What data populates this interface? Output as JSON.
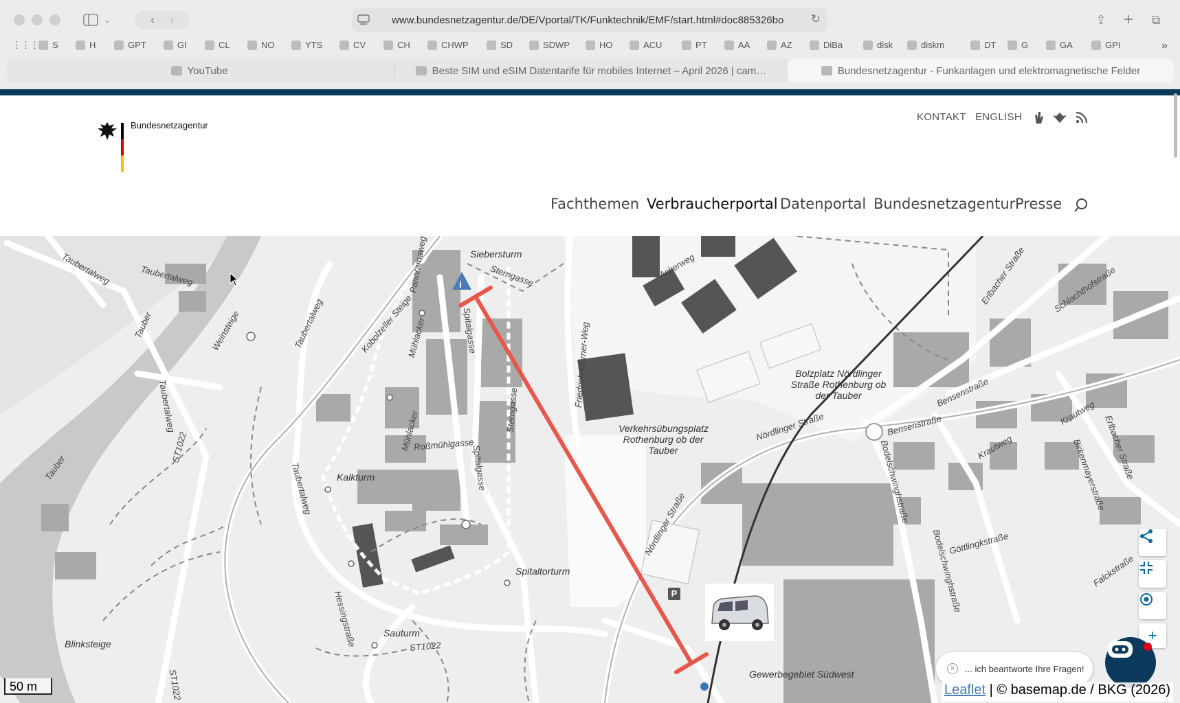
{
  "browser": {
    "url": "www.bundesnetzagentur.de/DE/Vportal/TK/Funktechnik/EMF/start.html#doc885326bo",
    "bookmarks": [
      "S",
      "H",
      "GPT",
      "GI",
      "CL",
      "NO",
      "YTS",
      "CV",
      "CH",
      "CHWP",
      "SD",
      "SDWP",
      "HO",
      "ACU",
      "PT",
      "AA",
      "AZ",
      "DiBa",
      "disk",
      "diskm",
      "DT",
      "G",
      "GA",
      "GPI"
    ],
    "tabs": [
      {
        "label": "YouTube",
        "active": false
      },
      {
        "label": "Beste SIM und eSIM Datentarife für mobiles Internet – April 2026 | cam…",
        "active": false
      },
      {
        "label": "Bundesnetzagentur - Funkanlagen und elektromagnetische Felder",
        "active": true
      }
    ]
  },
  "site": {
    "logo_text": "Bundesnetzagentur",
    "meta_links": [
      "KONTAKT",
      "ENGLISH"
    ],
    "nav": [
      "Fachthemen",
      "Verbraucherportal",
      "Datenportal",
      "Bundesnetzagentur",
      "Presse"
    ],
    "active_nav": "Verbraucherportal"
  },
  "map": {
    "street_labels": [
      "Taubertalweg",
      "Taubertalweg",
      "Taubertalweg",
      "Taubertalweg",
      "Taubertalweg",
      "Weinsteige",
      "Kobolzeller Steige",
      "Mühlacker",
      "Mühlacker",
      "Roßmühlgasse",
      "Panoramaweg",
      "Spitalgasse",
      "Spitalgasse",
      "Sterngasse",
      "Sterngasse",
      "Friedrich-Hörner-Weg",
      "Ackerweg",
      "Nördlinger Straße",
      "Nördlinger Straße",
      "Bensenstraße",
      "Bensenstraße",
      "Erlbacher Straße",
      "Schlachthofstraße",
      "Krautweg",
      "Krautweg",
      "Bodelschwinghstraße",
      "Bodelschwinghstraße",
      "Göttlingkstraße",
      "Birkenmayerstraße",
      "Erlbacher Straße",
      "Falckstraße",
      "Hessingstraße",
      "ST1022",
      "ST1022",
      "ST1022",
      "Tauber",
      "Tauber"
    ],
    "places": [
      "Siebersturm",
      "Kalkturm",
      "Spitaltorturm",
      "Sauturm",
      "Blinksteige",
      "Verkehrsübungsplatz Rothenburg ob der Tauber",
      "Bolzplatz Nördlinger Straße Rothenburg ob der Tauber",
      "Gewerbegebiet Südwest"
    ],
    "scale_label": "50 m",
    "attribution_link": "Leaflet",
    "attribution_text": " | © basemap.de / BKG (2026)",
    "parking_label": "P",
    "chat_prompt": "... ich beantworte Ihre Fragen!",
    "colors": {
      "measure_line": "#e8574b",
      "header_stripe": "#0b3a5c",
      "accent": "#0b6a9f"
    }
  }
}
